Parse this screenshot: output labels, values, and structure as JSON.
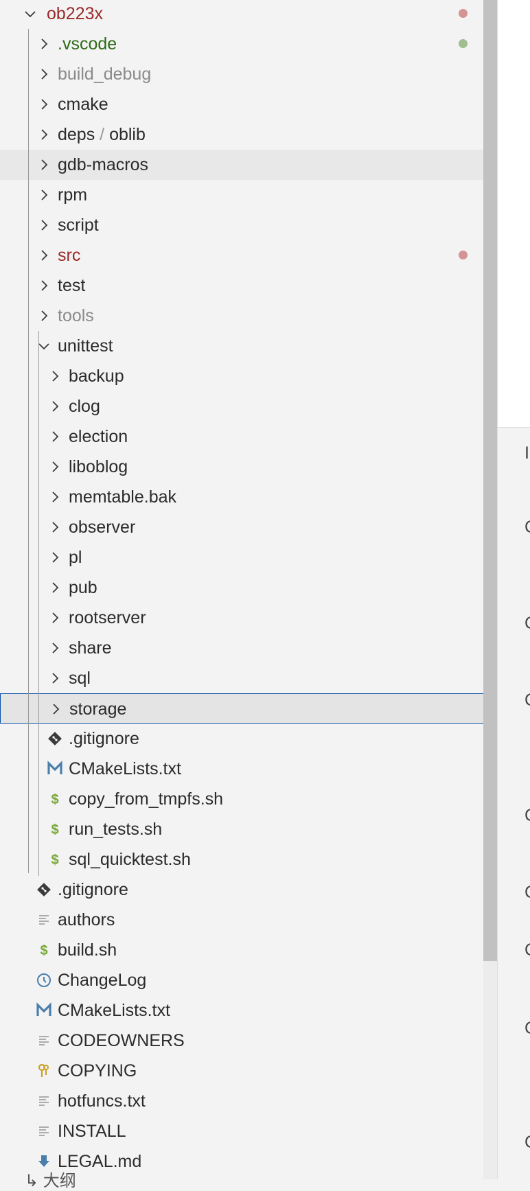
{
  "colors": {
    "modified_red": "#9a2a2a",
    "dot_red": "#d69393",
    "untracked_green": "#2e6b16",
    "dot_green": "#9fbf90",
    "ignored_gray": "#8a8a8a",
    "default_text": "#2b2b2b",
    "selection_border": "#0b4fa8"
  },
  "rows": [
    {
      "label": "ob223x",
      "type": "folder",
      "expanded": true,
      "depth": 0,
      "color": "#9a2a2a",
      "dot": "#d69393"
    },
    {
      "label": ".vscode",
      "type": "folder",
      "expanded": false,
      "depth": 1,
      "color": "#2e6b16",
      "dot": "#9fbf90"
    },
    {
      "label": "build_debug",
      "type": "folder",
      "expanded": false,
      "depth": 1,
      "color": "#8a8a8a"
    },
    {
      "label": "cmake",
      "type": "folder",
      "expanded": false,
      "depth": 1
    },
    {
      "label": "deps",
      "label_suffix": "oblib",
      "type": "folder",
      "expanded": false,
      "depth": 1
    },
    {
      "label": "gdb-macros",
      "type": "folder",
      "expanded": false,
      "depth": 1,
      "hover": true
    },
    {
      "label": "rpm",
      "type": "folder",
      "expanded": false,
      "depth": 1
    },
    {
      "label": "script",
      "type": "folder",
      "expanded": false,
      "depth": 1
    },
    {
      "label": "src",
      "type": "folder",
      "expanded": false,
      "depth": 1,
      "color": "#9a2a2a",
      "dot": "#d69393"
    },
    {
      "label": "test",
      "type": "folder",
      "expanded": false,
      "depth": 1
    },
    {
      "label": "tools",
      "type": "folder",
      "expanded": false,
      "depth": 1,
      "color": "#8a8a8a"
    },
    {
      "label": "unittest",
      "type": "folder",
      "expanded": true,
      "depth": 1
    },
    {
      "label": "backup",
      "type": "folder",
      "expanded": false,
      "depth": 2
    },
    {
      "label": "clog",
      "type": "folder",
      "expanded": false,
      "depth": 2
    },
    {
      "label": "election",
      "type": "folder",
      "expanded": false,
      "depth": 2
    },
    {
      "label": "liboblog",
      "type": "folder",
      "expanded": false,
      "depth": 2
    },
    {
      "label": "memtable.bak",
      "type": "folder",
      "expanded": false,
      "depth": 2
    },
    {
      "label": "observer",
      "type": "folder",
      "expanded": false,
      "depth": 2
    },
    {
      "label": "pl",
      "type": "folder",
      "expanded": false,
      "depth": 2
    },
    {
      "label": "pub",
      "type": "folder",
      "expanded": false,
      "depth": 2
    },
    {
      "label": "rootserver",
      "type": "folder",
      "expanded": false,
      "depth": 2
    },
    {
      "label": "share",
      "type": "folder",
      "expanded": false,
      "depth": 2
    },
    {
      "label": "sql",
      "type": "folder",
      "expanded": false,
      "depth": 2
    },
    {
      "label": "storage",
      "type": "folder",
      "expanded": false,
      "depth": 2,
      "selected": true
    },
    {
      "label": ".gitignore",
      "type": "file",
      "icon": "git-icon",
      "depth": 2
    },
    {
      "label": "CMakeLists.txt",
      "type": "file",
      "icon": "cmake-icon",
      "depth": 2
    },
    {
      "label": "copy_from_tmpfs.sh",
      "type": "file",
      "icon": "shell-icon",
      "depth": 2
    },
    {
      "label": "run_tests.sh",
      "type": "file",
      "icon": "shell-icon",
      "depth": 2
    },
    {
      "label": "sql_quicktest.sh",
      "type": "file",
      "icon": "shell-icon",
      "depth": 2
    },
    {
      "label": ".gitignore",
      "type": "file",
      "icon": "git-icon",
      "depth": 1
    },
    {
      "label": "authors",
      "type": "file",
      "icon": "text-lines-icon",
      "depth": 1
    },
    {
      "label": "build.sh",
      "type": "file",
      "icon": "shell-icon",
      "depth": 1
    },
    {
      "label": "ChangeLog",
      "type": "file",
      "icon": "clock-icon",
      "depth": 1
    },
    {
      "label": "CMakeLists.txt",
      "type": "file",
      "icon": "cmake-icon",
      "depth": 1
    },
    {
      "label": "CODEOWNERS",
      "type": "file",
      "icon": "text-lines-icon",
      "depth": 1
    },
    {
      "label": "COPYING",
      "type": "file",
      "icon": "license-key-icon",
      "depth": 1
    },
    {
      "label": "hotfuncs.txt",
      "type": "file",
      "icon": "text-lines-icon",
      "depth": 1
    },
    {
      "label": "INSTALL",
      "type": "file",
      "icon": "text-lines-icon",
      "depth": 1
    },
    {
      "label": "LEGAL.md",
      "type": "file",
      "icon": "markdown-download-icon",
      "depth": 1
    }
  ],
  "right_panel_cut_letters": [
    "I",
    "C",
    "C",
    "C",
    "C",
    "C",
    "C",
    "C",
    "C"
  ],
  "bottom_cut_text": "↳ 大纲"
}
